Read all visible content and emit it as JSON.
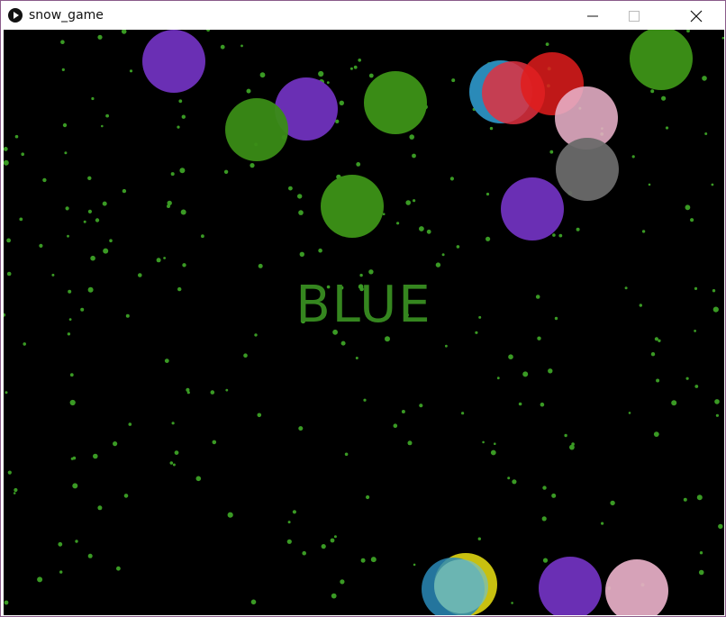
{
  "window": {
    "title": "snow_game",
    "icon": "play-icon",
    "controls": [
      "minimize-icon",
      "maximize-icon",
      "close-icon"
    ]
  },
  "game": {
    "target_word": "BLUE",
    "word_color": "#35861f",
    "snow_color": "#3a9a24",
    "ball_colors": {
      "purple": "#6a2fb4",
      "green": "#3a8c16",
      "blue": "#2a8ab8",
      "red": "#e03030",
      "pink": "#e8a8c4",
      "gray": "#6a6a6a",
      "yellow": "#c8c010"
    }
  }
}
